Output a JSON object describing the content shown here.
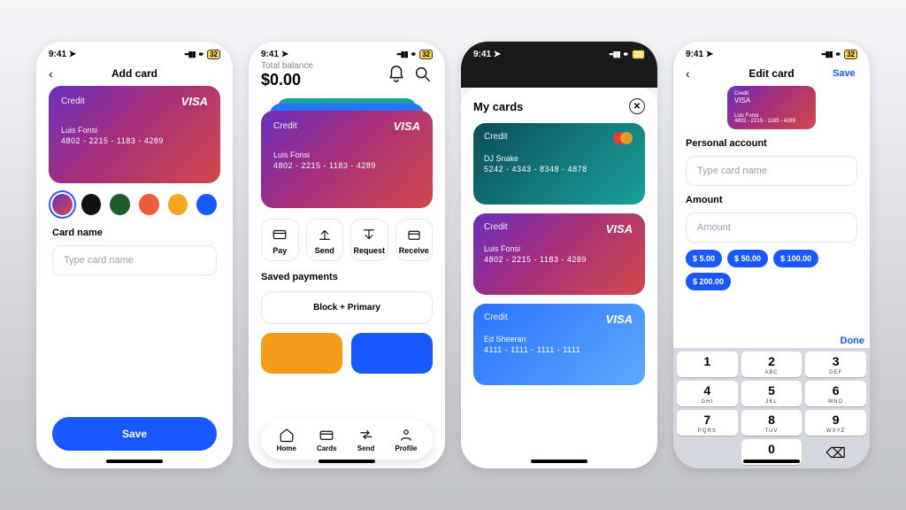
{
  "status": {
    "time": "9:41",
    "battery": "32"
  },
  "screen1": {
    "title": "Add card",
    "card": {
      "label": "Credit",
      "brand": "VISA",
      "holder": "Luis Fonsi",
      "number": "4802 - 2215 - 1183 - 4289"
    },
    "swatches": [
      "linear-gradient(135deg,#6a2fbf,#d14a4a)",
      "#111111",
      "#1f5d2a",
      "#ef5a3a",
      "#f5a623",
      "#1957ff"
    ],
    "card_name_label": "Card name",
    "card_name_placeholder": "Type card name",
    "save": "Save"
  },
  "screen2": {
    "total_label": "Total balance",
    "total_amount": "$0.00",
    "card": {
      "label": "Credit",
      "brand": "VISA",
      "holder": "Luis Fonsi",
      "number": "4802 - 2215 - 1183 - 4289"
    },
    "actions": [
      "Pay",
      "Send",
      "Request",
      "Receive"
    ],
    "saved_label": "Saved payments",
    "saved_item": "Block + Primary",
    "tabs": [
      "Home",
      "Cards",
      "Send",
      "Profile"
    ]
  },
  "screen3": {
    "title": "My cards",
    "cards": [
      {
        "label": "Credit",
        "brand": "mastercard",
        "holder": "DJ Snake",
        "number": "5242 - 4343 - 8348 - 4878",
        "grad": "grad-teal"
      },
      {
        "label": "Credit",
        "brand": "VISA",
        "holder": "Luis Fonsi",
        "number": "4802 - 2215 - 1183 - 4289",
        "grad": "grad-red"
      },
      {
        "label": "Credit",
        "brand": "VISA",
        "holder": "Ed Sheeran",
        "number": "4111 - 1111 - 1111 - 1111",
        "grad": "grad-blue"
      }
    ]
  },
  "screen4": {
    "title": "Edit card",
    "save": "Save",
    "card": {
      "label": "Credit",
      "brand": "VISA",
      "holder": "Luis Fonsi",
      "number": "4802 - 2215 - 1183 - 4289"
    },
    "personal_label": "Personal account",
    "personal_placeholder": "Type card name",
    "amount_label": "Amount",
    "amount_placeholder": "Amount",
    "chips": [
      "$ 5.00",
      "$ 50.00",
      "$ 100.00",
      "$ 200.00"
    ],
    "done": "Done",
    "keypad": [
      {
        "d": "1",
        "l": ""
      },
      {
        "d": "2",
        "l": "ABC"
      },
      {
        "d": "3",
        "l": "DEF"
      },
      {
        "d": "4",
        "l": "GHI"
      },
      {
        "d": "5",
        "l": "JKL"
      },
      {
        "d": "6",
        "l": "MNO"
      },
      {
        "d": "7",
        "l": "PQRS"
      },
      {
        "d": "8",
        "l": "TUV"
      },
      {
        "d": "9",
        "l": "WXYZ"
      },
      {
        "d": "",
        "l": ""
      },
      {
        "d": "0",
        "l": ""
      },
      {
        "d": "⌫",
        "l": ""
      }
    ]
  }
}
